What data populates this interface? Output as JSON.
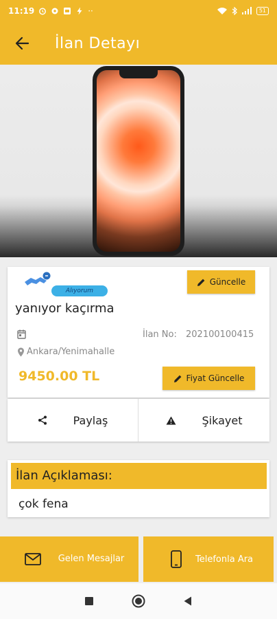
{
  "status_bar": {
    "time": "11:19",
    "battery": "51"
  },
  "app_bar": {
    "title": "İlan Detayı"
  },
  "listing": {
    "badge": "Alıyorum",
    "update_label": "Güncelle",
    "title": "yanıyor kaçırma",
    "ilan_no_label": "İlan No:",
    "ilan_no": "202100100415",
    "location": "Ankara/Yenimahalle",
    "price": "9450.00 TL",
    "price_update_label": "Fiyat Güncelle"
  },
  "actions": {
    "share": "Paylaş",
    "complaint": "Şikayet"
  },
  "description": {
    "header": "İlan Açıklaması:",
    "text": "çok fena"
  },
  "bottom": {
    "messages": "Gelen Mesajlar",
    "call": "Telefonla Ara"
  },
  "colors": {
    "accent": "#f0b92a",
    "badge": "#3cb0e6"
  }
}
